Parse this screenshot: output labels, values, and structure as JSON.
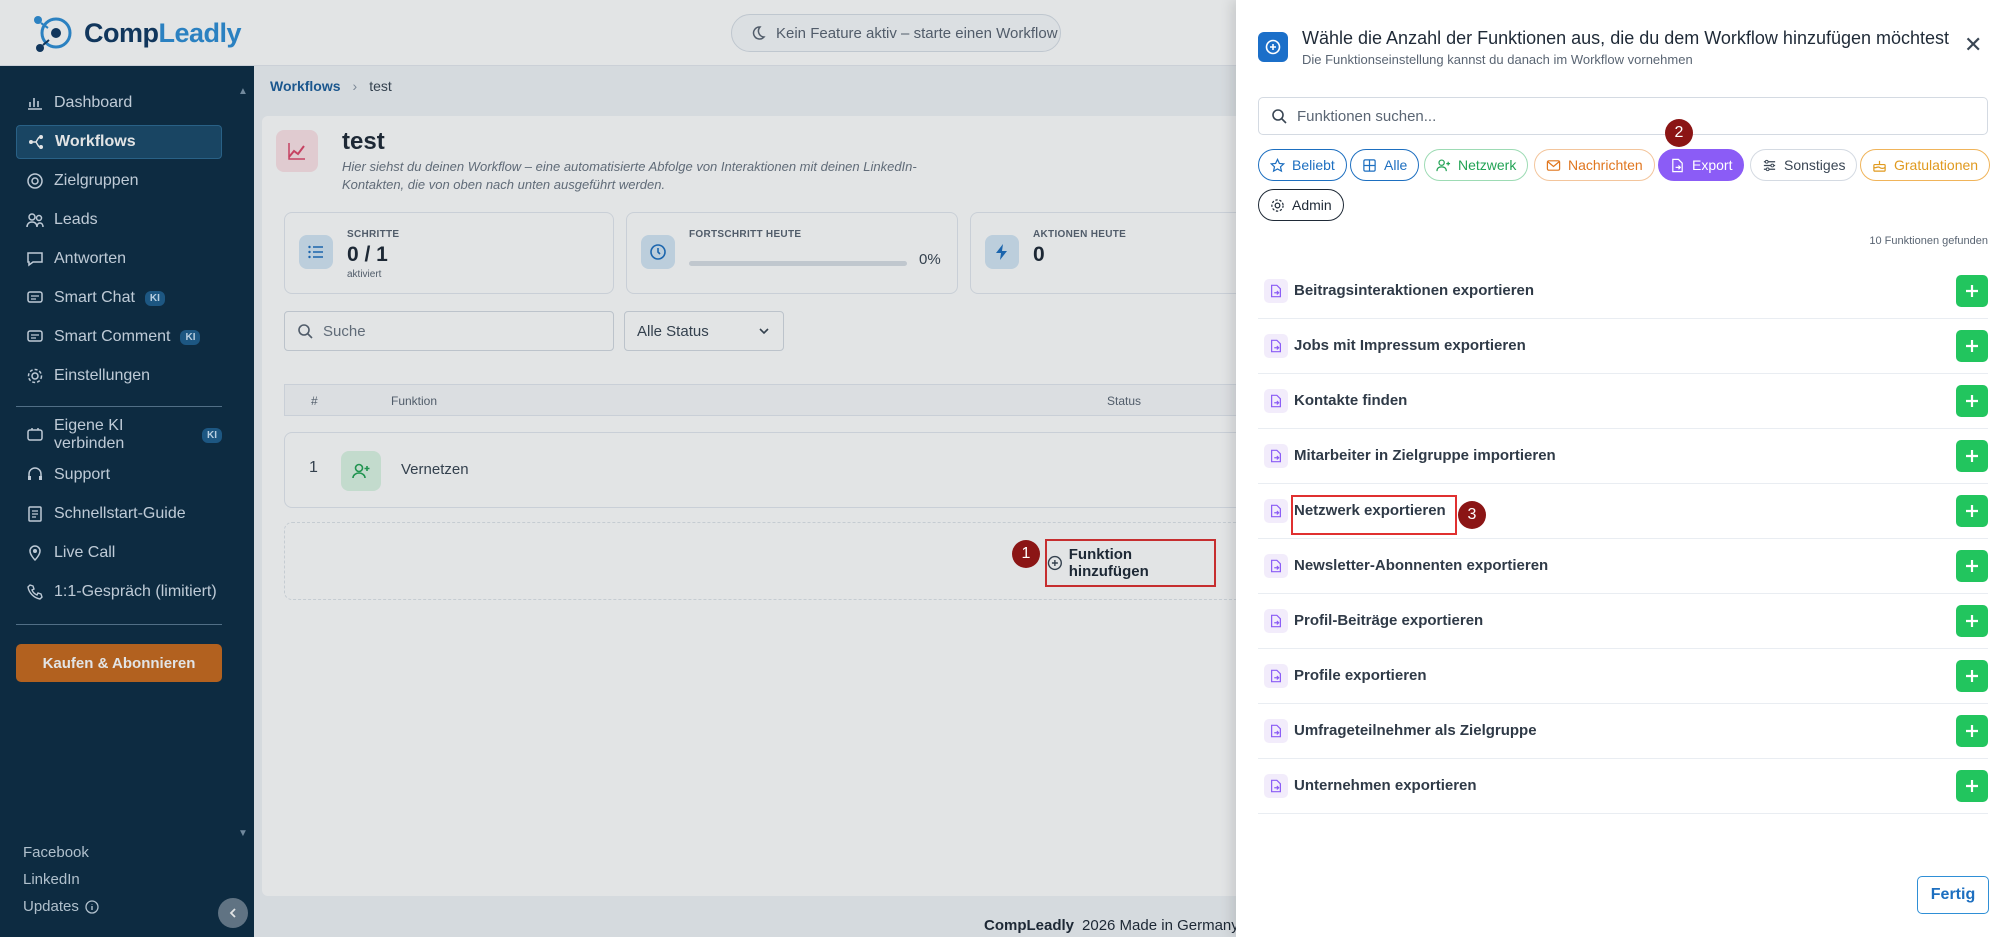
{
  "app": {
    "logo_prefix": "Comp",
    "logo_accent": "Leadly",
    "feature_status": "Kein Feature aktiv – starte einen Workflow"
  },
  "sidebar": {
    "items": [
      {
        "label": "Dashboard",
        "icon": "dashboard-icon"
      },
      {
        "label": "Workflows",
        "icon": "workflow-icon",
        "active": true
      },
      {
        "label": "Zielgruppen",
        "icon": "target-icon"
      },
      {
        "label": "Leads",
        "icon": "users-icon"
      },
      {
        "label": "Antworten",
        "icon": "message-icon"
      },
      {
        "label": "Smart Chat",
        "icon": "chat-icon",
        "badge": "KI"
      },
      {
        "label": "Smart Comment",
        "icon": "comment-icon",
        "badge": "KI"
      },
      {
        "label": "Einstellungen",
        "icon": "gear-icon"
      }
    ],
    "items2": [
      {
        "label": "Eigene KI verbinden",
        "icon": "ai-plug-icon",
        "badge": "KI"
      },
      {
        "label": "Support",
        "icon": "support-icon"
      },
      {
        "label": "Schnellstart-Guide",
        "icon": "book-icon"
      },
      {
        "label": "Live Call",
        "icon": "pin-icon"
      },
      {
        "label": "1:1-Gespräch (limitiert)",
        "icon": "phone-icon"
      }
    ],
    "buy_label": "Kaufen & Abonnieren",
    "links": [
      "Facebook",
      "LinkedIn",
      "Updates"
    ]
  },
  "breadcrumb": {
    "root": "Workflows",
    "current": "test"
  },
  "workflow": {
    "title": "test",
    "description": "Hier siehst du deinen Workflow – eine automatisierte Abfolge von Interaktionen mit deinen LinkedIn-Kontakten, die von oben nach unten ausgeführt werden.",
    "stats": {
      "steps_label": "SCHRITTE",
      "steps_value": "0 / 1",
      "steps_sub": "aktiviert",
      "progress_label": "FORTSCHRITT HEUTE",
      "progress_value": "0%",
      "progress_fraction": 0,
      "actions_label": "AKTIONEN HEUTE",
      "actions_value": "0"
    },
    "search_placeholder": "Suche",
    "status_filter": "Alle Status",
    "table": {
      "headers": [
        "#",
        "Funktion",
        "Status"
      ],
      "rows": [
        {
          "num": "1",
          "name": "Vernetzen"
        }
      ]
    },
    "add_function_label": "Funktion hinzufügen"
  },
  "footer": {
    "brand": "CompLeadly",
    "text": "2026 Made in Germany"
  },
  "markers": {
    "one": "1",
    "two": "2",
    "three": "3"
  },
  "drawer": {
    "title": "Wähle die Anzahl der Funktionen aus, die du dem Workflow hinzufügen möchtest",
    "subtitle": "Die Funktionseinstellung kannst du danach im Workflow vornehmen",
    "search_placeholder": "Funktionen suchen...",
    "chips": [
      {
        "label": "Beliebt",
        "icon": "star-icon",
        "color": "#1d6fc0"
      },
      {
        "label": "Alle",
        "icon": "grid-icon",
        "color": "#1d6fc0"
      },
      {
        "label": "Netzwerk",
        "icon": "user-plus-icon",
        "color": "#22a355"
      },
      {
        "label": "Nachrichten",
        "icon": "mail-icon",
        "color": "#e0761f"
      },
      {
        "label": "Export",
        "icon": "file-export-icon",
        "color": "#8b5cf6",
        "active": true
      },
      {
        "label": "Sonstiges",
        "icon": "sliders-icon",
        "color": "#3a4654"
      },
      {
        "label": "Gratulationen",
        "icon": "cake-icon",
        "color": "#e09a1f"
      },
      {
        "label": "Admin",
        "icon": "gear-icon",
        "color": "#1f2a37"
      }
    ],
    "found_label": "10 Funktionen gefunden",
    "functions": [
      "Beitragsinteraktionen exportieren",
      "Jobs mit Impressum exportieren",
      "Kontakte finden",
      "Mitarbeiter in Zielgruppe importieren",
      "Netzwerk exportieren",
      "Newsletter-Abonnenten exportieren",
      "Profil-Beiträge exportieren",
      "Profile exportieren",
      "Umfrageteilnehmer als Zielgruppe",
      "Unternehmen exportieren"
    ],
    "done_label": "Fertig"
  },
  "colors": {
    "sidebar_bg": "#0d2d45",
    "accent": "#1d6fc0",
    "export_chip": "#8b5cf6",
    "add_green": "#22c55e",
    "marker_red": "#8b1515",
    "buy_orange": "#c96a1e"
  }
}
